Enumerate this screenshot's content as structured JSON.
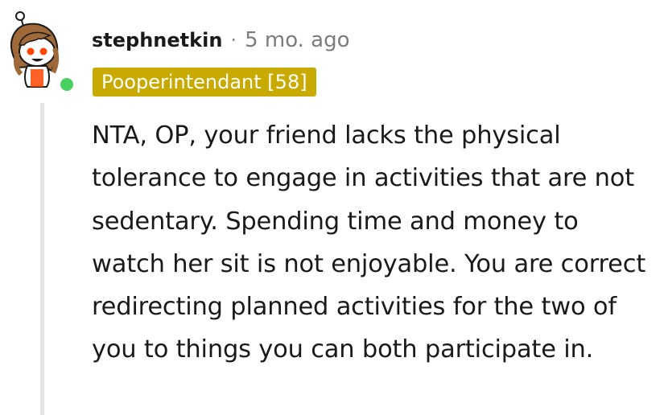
{
  "comment": {
    "username": "stephnetkin",
    "separator": "·",
    "timestamp": "5 mo. ago",
    "flair": "Pooperintendant [58]",
    "body": "NTA, OP, your friend lacks the physical tolerance to engage in activities that are not sedentary. Spending time and money to watch her sit is not enjoyable. You are correct redirecting planned activities for the two of you to things you can both participate in."
  },
  "avatar": {
    "icon": "snoo-avatar-icon",
    "online_status_color": "#46d160"
  },
  "colors": {
    "flair_background": "#c9aa00",
    "flair_text": "#ffffff",
    "thread_line": "#e4e5e6",
    "timestamp": "#7c7c7c"
  }
}
